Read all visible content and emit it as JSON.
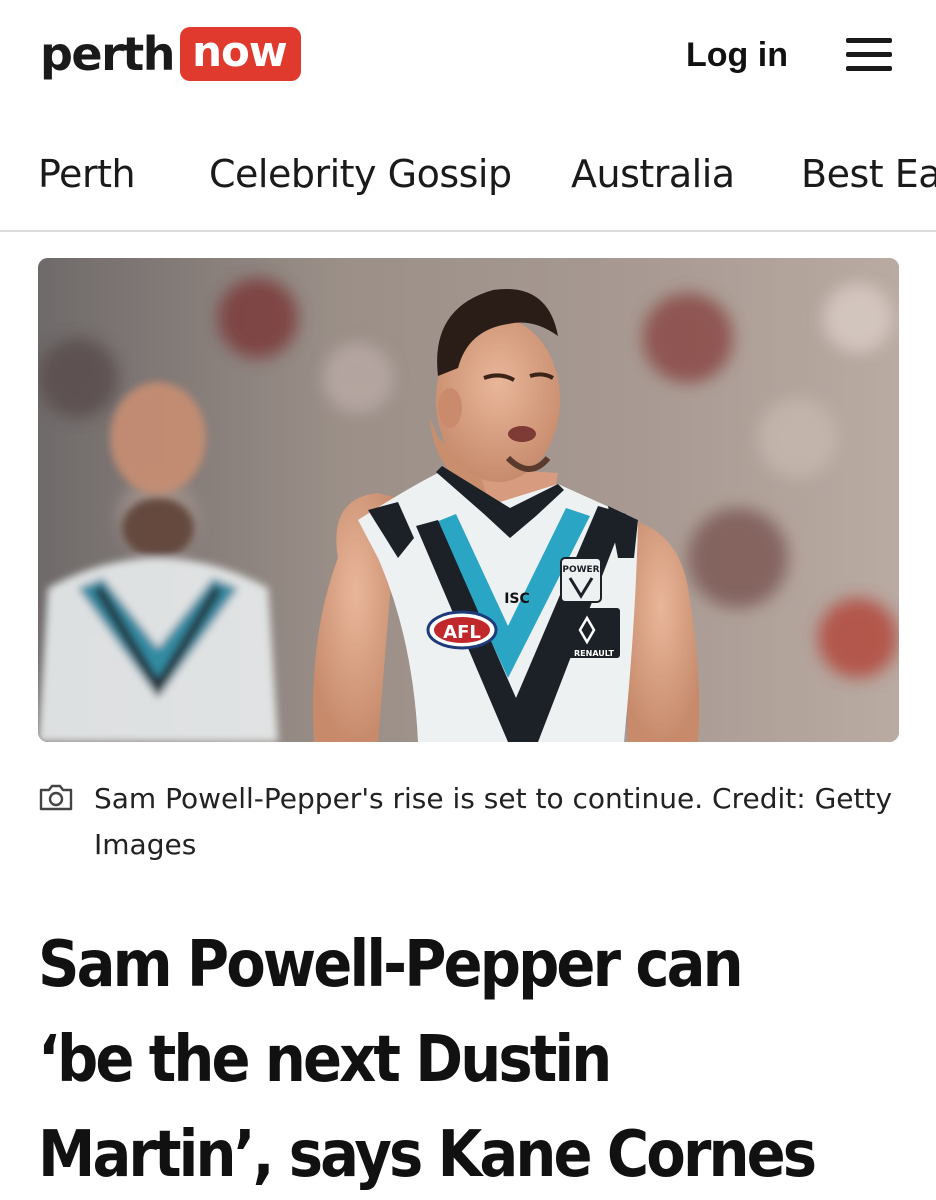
{
  "header": {
    "logo": {
      "part1": "perth",
      "part2": "now"
    },
    "login_label": "Log in",
    "menu_icon": "hamburger-menu-icon"
  },
  "nav": {
    "items": [
      {
        "label": "Perth"
      },
      {
        "label": "Celebrity Gossip"
      },
      {
        "label": "Australia"
      },
      {
        "label": "Best Eat"
      }
    ]
  },
  "article": {
    "caption_icon": "camera-icon",
    "caption": "Sam Powell-Pepper's rise is set to continue. Credit: Getty Images",
    "headline": "Sam Powell-Pepper can ‘be the next Dustin Martin’, says Kane Cornes",
    "hero_jersey": {
      "isc": "ISC",
      "afl": "AFL",
      "sponsor": "RENAULT",
      "club": "POWER"
    }
  },
  "colors": {
    "brand_red": "#e03a2f",
    "text": "#1a1a1a",
    "divider": "#dcdcdc",
    "jersey_teal": "#2aa5c4"
  }
}
